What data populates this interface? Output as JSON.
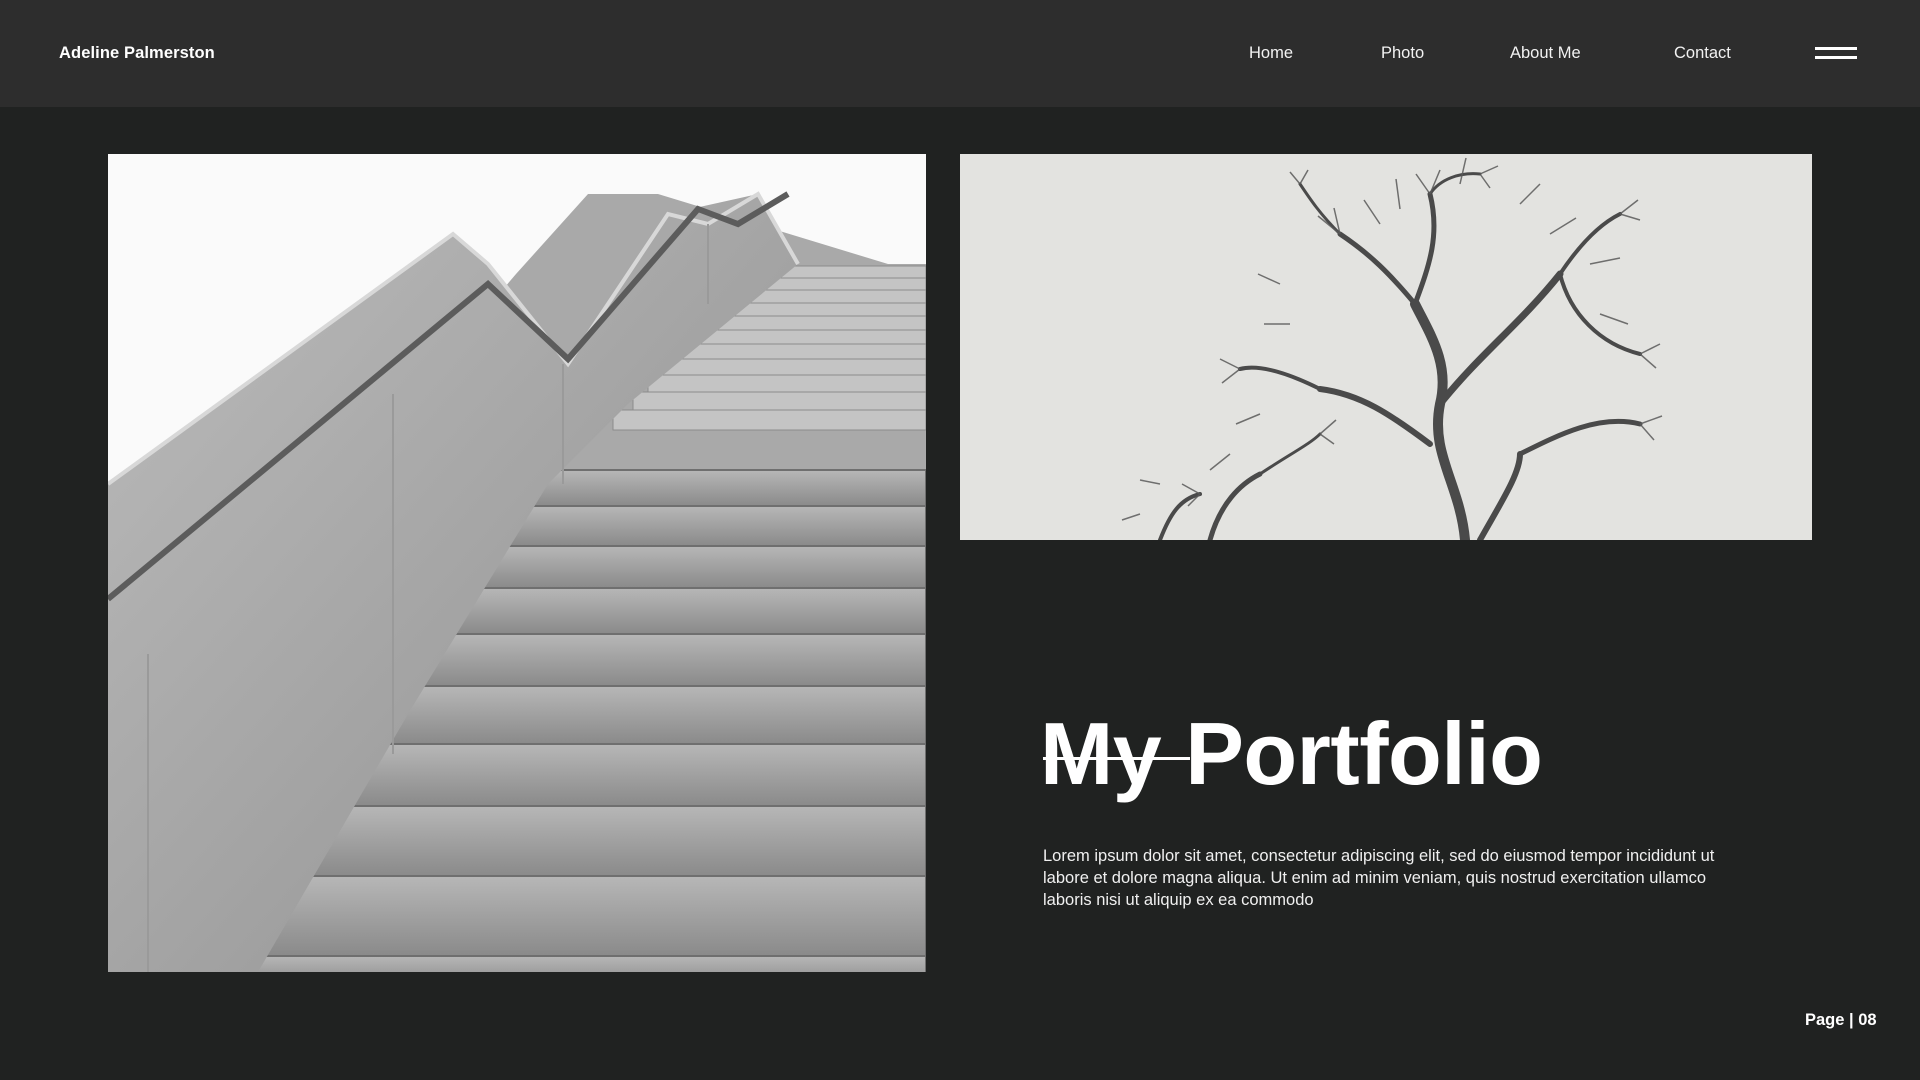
{
  "header": {
    "brand": "Adeline Palmerston",
    "nav": {
      "home": "Home",
      "photo": "Photo",
      "about": "About Me",
      "contact": "Contact"
    },
    "menu_icon": "hamburger-menu-icon"
  },
  "main": {
    "title": "My Portfolio",
    "body": "Lorem ipsum dolor sit amet, consectetur adipiscing elit, sed do eiusmod tempor incididunt ut labore et dolore magna aliqua. Ut enim ad minim veniam, quis nostrud exercitation ullamco laboris nisi ut aliquip ex ea commodo",
    "images": {
      "left": "concrete-staircase-photo",
      "right": "bare-tree-silhouette-photo"
    }
  },
  "footer": {
    "page_label": "Page | 08"
  },
  "colors": {
    "background": "#202221",
    "header_background": "#2d2d2d",
    "text": "#ffffff"
  }
}
